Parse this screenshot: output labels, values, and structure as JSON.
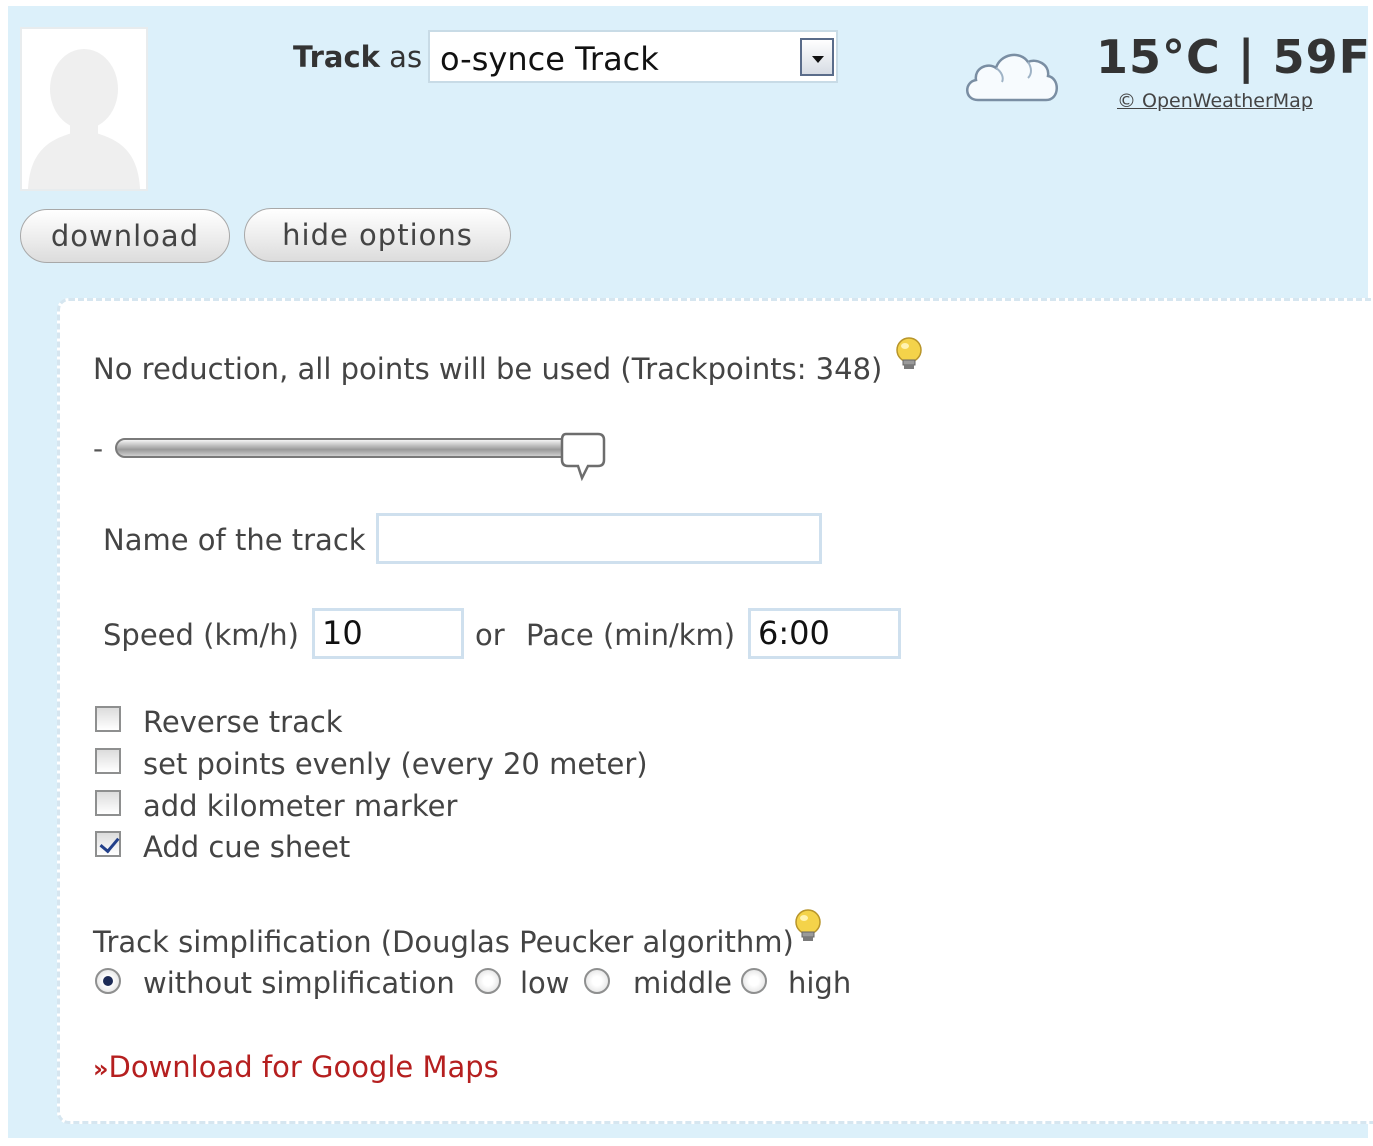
{
  "header": {
    "track_as_label_strong": "Track",
    "track_as_label_rest": " as",
    "track_type_selected": "o-synce Track",
    "temperature": "15°C | 59F",
    "weather_credit": "© OpenWeatherMap",
    "weather_icon": "cloud-icon"
  },
  "buttons": {
    "download": "download",
    "hide_options": "hide options"
  },
  "options": {
    "reduction_text": "No reduction, all points will be used (Trackpoints: 348)",
    "slider_minus": "-",
    "slider_level": 1.0,
    "track_name_label": "Name of the track",
    "track_name_value": "",
    "speed_label": "Speed (km/h)",
    "speed_value": "10",
    "or_label": "or",
    "pace_label": "Pace (min/km)",
    "pace_value": "6:00",
    "checkboxes": [
      {
        "label": "Reverse track",
        "checked": false
      },
      {
        "label": "set points evenly (every 20 meter)",
        "checked": false
      },
      {
        "label": "add kilometer marker",
        "checked": false
      },
      {
        "label": "Add cue sheet",
        "checked": true
      }
    ],
    "simplification_label": "Track simplification (Douglas Peucker algorithm)",
    "simplification_options": [
      {
        "label": "without simplification",
        "checked": true
      },
      {
        "label": "low",
        "checked": false
      },
      {
        "label": "middle",
        "checked": false
      },
      {
        "label": "high",
        "checked": false
      }
    ],
    "google_maps_link_prefix": "»",
    "google_maps_link": "Download for Google Maps"
  },
  "colors": {
    "panel_bg": "#dcf0fa",
    "link": "#b51f1f",
    "bulb": "#f4d34a"
  }
}
